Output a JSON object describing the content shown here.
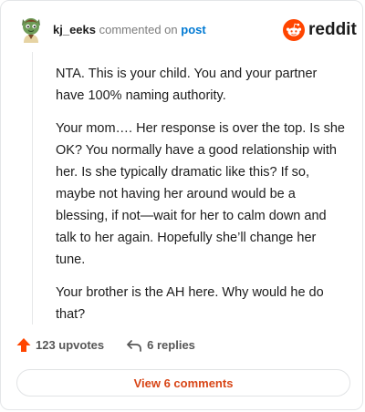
{
  "comment": {
    "username": "kj_eeks",
    "action": "commented on",
    "post_link": "post",
    "paragraphs": [
      "NTA. This is your child. You and your partner have 100% naming authority.",
      "Your mom…. Her response is over the top. Is she OK? You normally have a good relationship with her. Is she typically dramatic like this? If so, maybe not having her around would be a blessing, if not—wait for her to calm down and talk to her again. Hopefully she’ll change her tune.",
      "Your brother is the AH here. Why would he do that?"
    ]
  },
  "brand": {
    "name": "reddit",
    "color": "#ff4500"
  },
  "stats": {
    "upvotes": "123 upvotes",
    "replies": "6 replies"
  },
  "view_comments_label": "View 6 comments",
  "icons": {
    "avatar": "avatar-icon",
    "upvote": "upvote-arrow-icon",
    "reply": "reply-arrow-icon",
    "logo": "reddit-snoo-icon"
  },
  "colors": {
    "username": "#1c1c1c",
    "link": "#0079d3",
    "upvote": "#ff4500",
    "view_comments": "#d84516"
  }
}
